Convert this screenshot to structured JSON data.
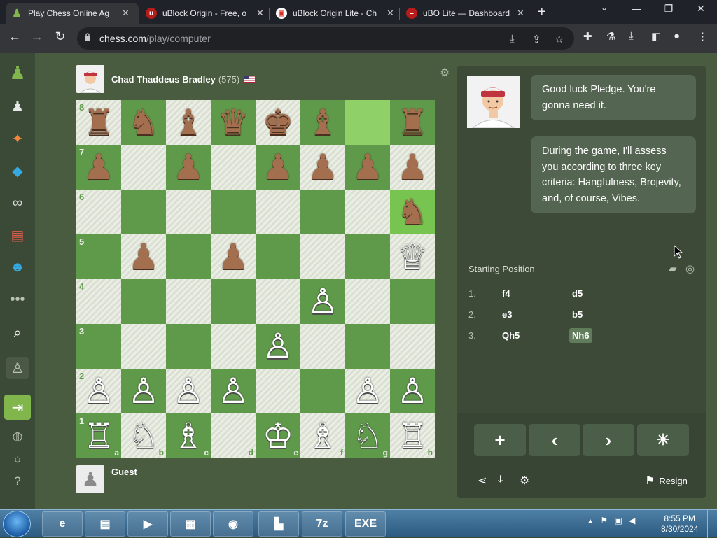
{
  "browser": {
    "tabs": [
      {
        "title": "Play Chess Online Ag",
        "active": true,
        "fav_color": "#81b64c",
        "fav_icon": "pawn-icon"
      },
      {
        "title": "uBlock Origin - Free, o",
        "active": false,
        "fav_color": "#b71c1c",
        "fav_icon": "ublock-icon"
      },
      {
        "title": "uBlock Origin Lite - Ch",
        "active": false,
        "fav_color": "#ffffff",
        "fav_icon": "webstore-icon"
      },
      {
        "title": "uBO Lite — Dashboard",
        "active": false,
        "fav_color": "#b71c1c",
        "fav_icon": "ubo-lite-icon"
      }
    ],
    "url_host": "chess.com",
    "url_path": "/play/computer"
  },
  "opponent": {
    "name": "Chad Thaddeus Bradley",
    "rating": "(575)"
  },
  "player": {
    "name": "Guest"
  },
  "board": {
    "rows": [
      [
        "♜",
        "♞",
        "♝",
        "♛",
        "♚",
        "♝",
        "",
        "♜"
      ],
      [
        "♟",
        "",
        "♟",
        "",
        "♟",
        "♟",
        "♟",
        "♟"
      ],
      [
        "",
        "",
        "",
        "",
        "",
        "",
        "",
        "♞"
      ],
      [
        "",
        "♟",
        "",
        "♟",
        "",
        "",
        "",
        "♕"
      ],
      [
        "",
        "",
        "",
        "",
        "",
        "♙",
        "",
        ""
      ],
      [
        "",
        "",
        "",
        "",
        "♙",
        "",
        "",
        ""
      ],
      [
        "♙",
        "♙",
        "♙",
        "♙",
        "",
        "",
        "♙",
        "♙"
      ],
      [
        "♖",
        "♘",
        "♗",
        "",
        "♔",
        "♗",
        "♘",
        "♖"
      ]
    ],
    "colors": [
      [
        "b",
        "b",
        "b",
        "b",
        "b",
        "b",
        "",
        "b"
      ],
      [
        "b",
        "",
        "b",
        "",
        "b",
        "b",
        "b",
        "b"
      ],
      [
        "",
        "",
        "",
        "",
        "",
        "",
        "",
        "b"
      ],
      [
        "",
        "b",
        "",
        "b",
        "",
        "",
        "",
        "w"
      ],
      [
        "",
        "",
        "",
        "",
        "",
        "w",
        "",
        ""
      ],
      [
        "",
        "",
        "",
        "",
        "w",
        "",
        "",
        ""
      ],
      [
        "w",
        "w",
        "w",
        "w",
        "",
        "",
        "w",
        "w"
      ],
      [
        "w",
        "w",
        "w",
        "",
        "w",
        "w",
        "w",
        "w"
      ]
    ],
    "ranks": [
      "8",
      "7",
      "6",
      "5",
      "4",
      "3",
      "2",
      "1"
    ],
    "files": [
      "a",
      "b",
      "c",
      "d",
      "e",
      "f",
      "g",
      "h"
    ],
    "highlighted": [
      "g8",
      "h6"
    ],
    "light_color": "#eaeee5",
    "dark_color": "#5f9a4a"
  },
  "coach": {
    "messages": [
      "Good luck Pledge. You're gonna need it.",
      "During the game, I'll assess you according to three key criteria: Hangfulness, Brojevity, and, of course, Vibes."
    ]
  },
  "opening": "Starting Position",
  "moves": [
    {
      "num": "1.",
      "white": "f4",
      "black": "d5"
    },
    {
      "num": "2.",
      "white": "e3",
      "black": "b5"
    },
    {
      "num": "3.",
      "white": "Qh5",
      "black": "Nh6"
    }
  ],
  "controls": {
    "resign_label": "Resign"
  },
  "taskbar": {
    "time": "8:55 PM",
    "date": "8/30/2024",
    "items": [
      {
        "name": "ie-icon",
        "label": "e"
      },
      {
        "name": "explorer-icon",
        "label": "▤"
      },
      {
        "name": "media-player-icon",
        "label": "▶"
      },
      {
        "name": "control-panel-icon",
        "label": "▦"
      },
      {
        "name": "chrome-icon",
        "label": "◉"
      },
      {
        "name": "building-icon",
        "label": "▙"
      },
      {
        "name": "7zip-icon",
        "label": "7z"
      },
      {
        "name": "youtube-exe-icon",
        "label": "EXE"
      }
    ]
  }
}
